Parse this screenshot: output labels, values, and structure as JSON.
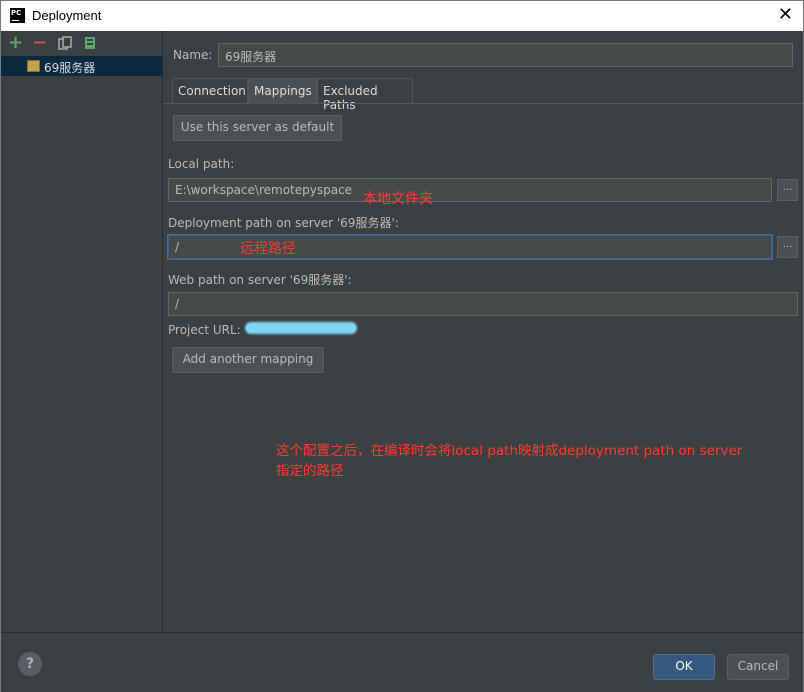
{
  "window": {
    "title": "Deployment",
    "app_icon_text": "PC"
  },
  "toolbar": {
    "add": "+",
    "remove": "−"
  },
  "servers": [
    {
      "label": "69服务器"
    }
  ],
  "form": {
    "name_label": "Name:",
    "name_value": "69服务器",
    "tabs": [
      {
        "label": "Connection"
      },
      {
        "label": "Mappings",
        "active": true
      },
      {
        "label": "Excluded Paths"
      }
    ],
    "default_button": "Use this server as default",
    "local_path_label": "Local path:",
    "local_path_value": "E:\\workspace\\remotepyspace",
    "deployment_path_label": "Deployment path on server '69服务器':",
    "deployment_path_value": "/",
    "web_path_label": "Web path on server '69服务器':",
    "web_path_value": "/",
    "project_url_label": "Project URL:",
    "add_mapping_button": "Add another mapping",
    "browse": "..."
  },
  "annotations": {
    "local": "本地文件夹",
    "remote": "远程路径",
    "note_line1": "这个配置之后，在编译时会将local path映射成deployment path on server",
    "note_line2": "指定的路径"
  },
  "footer": {
    "help": "?",
    "ok": "OK",
    "cancel": "Cancel"
  },
  "colors": {
    "background": "#3c3f41",
    "field": "#45494a",
    "selection": "#0d293e",
    "primary_button": "#365880",
    "annotation": "#ff3b30"
  }
}
